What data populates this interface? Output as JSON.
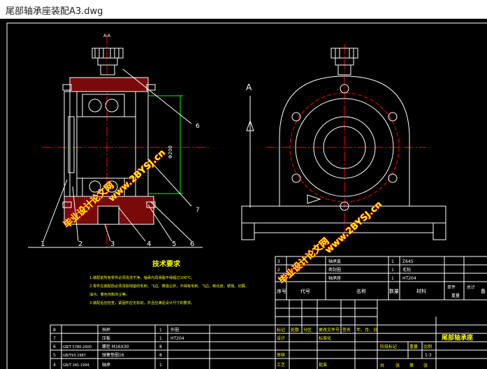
{
  "window": {
    "title": "尾部轴承座装配A3.dwg"
  },
  "drawing": {
    "balloons": [
      "1",
      "2",
      "3",
      "4",
      "5",
      "6"
    ],
    "callout_6": "6",
    "callout_7": "7",
    "section_mark": "A",
    "section_mark_top": "A-A",
    "dim_label": "Φ200",
    "watermark_1": "毕业设计论文网",
    "watermark_1b": "www.2BYSJ.cn",
    "watermark_2": "毕业设计论文网",
    "watermark_2b": "www.2BYSJ.cn",
    "tech_title": "技术要求",
    "tech_lines": [
      "1.装配前所有零件必须清洗干净，轴承内润滑脂不得超过100℃。",
      "2.零件在装配前必须清除残留的毛刺、飞边、铸造尘砂，不得有毛刺、飞边、氧化皮、锈蚀、切屑、",
      "油污、着色剂和灰尘等。",
      "3.装配后应检查，紧固件应无松动，并且应满足设计尺寸的要求。"
    ],
    "parts_right": [
      {
        "no": "3",
        "name": "轴承盖",
        "qty": "1",
        "mat": "Z645"
      },
      {
        "no": "2",
        "name": "密封圈",
        "qty": "1",
        "mat": "毛毡"
      },
      {
        "no": "1",
        "name": "轴承座",
        "qty": "1",
        "mat": "HT204"
      }
    ],
    "parts_header": {
      "no": "序号",
      "code": "代号",
      "name": "名称",
      "qty": "数量",
      "mat": "材料",
      "unit": "单件",
      "total": "总计",
      "weight": "重量",
      "note": "备"
    },
    "parts_left": [
      {
        "no": "8",
        "code": "",
        "name": "挡杯",
        "qty": "1",
        "mat": "外圈"
      },
      {
        "no": "7",
        "code": "",
        "name": "压板",
        "qty": "1",
        "mat": "HT204"
      },
      {
        "no": "6",
        "code": "GB/T 5780-2000",
        "name": "螺栓 M16X30",
        "qty": "8",
        "mat": ""
      },
      {
        "no": "5",
        "code": "GB/T93-1987",
        "name": "弹簧垫圈16",
        "qty": "8",
        "mat": ""
      },
      {
        "no": "4",
        "code": "GB/T 281-1994",
        "name": "轴承",
        "qty": "1",
        "mat": ""
      }
    ],
    "title_block": {
      "title": "尾部轴承座",
      "row_labels": [
        "标记",
        "处数",
        "分区",
        "更改文件号",
        "签名",
        "年、月、日"
      ],
      "design": "设计",
      "std": "标准化",
      "audit": "审核",
      "process": "工艺",
      "approve": "批准",
      "stage": "阶段标记",
      "weight": "重量",
      "scale": "比例",
      "scale_val": "1:3",
      "sheets": "共",
      "sheet": "张",
      "of": "第",
      "zhang": "张"
    }
  }
}
